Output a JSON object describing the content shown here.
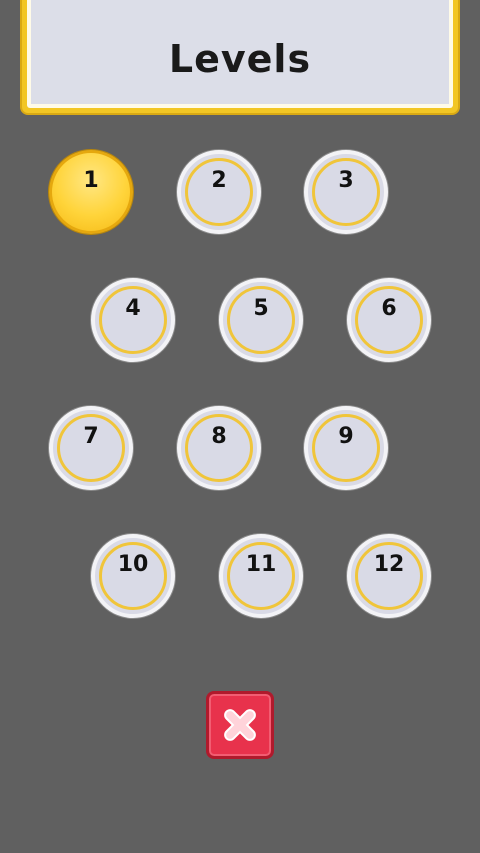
{
  "header": {
    "title": "Levels"
  },
  "levels": [
    {
      "label": "1",
      "state": "current"
    },
    {
      "label": "2",
      "state": "available"
    },
    {
      "label": "3",
      "state": "available"
    },
    {
      "label": "4",
      "state": "available"
    },
    {
      "label": "5",
      "state": "available"
    },
    {
      "label": "6",
      "state": "available"
    },
    {
      "label": "7",
      "state": "available"
    },
    {
      "label": "8",
      "state": "available"
    },
    {
      "label": "9",
      "state": "available"
    },
    {
      "label": "10",
      "state": "available"
    },
    {
      "label": "11",
      "state": "available"
    },
    {
      "label": "12",
      "state": "available"
    }
  ],
  "close_button": {
    "icon": "close-icon"
  },
  "colors": {
    "background": "#606060",
    "accent_yellow": "#f2c624",
    "button_face": "#d9dae6",
    "close_red": "#e8324c"
  }
}
